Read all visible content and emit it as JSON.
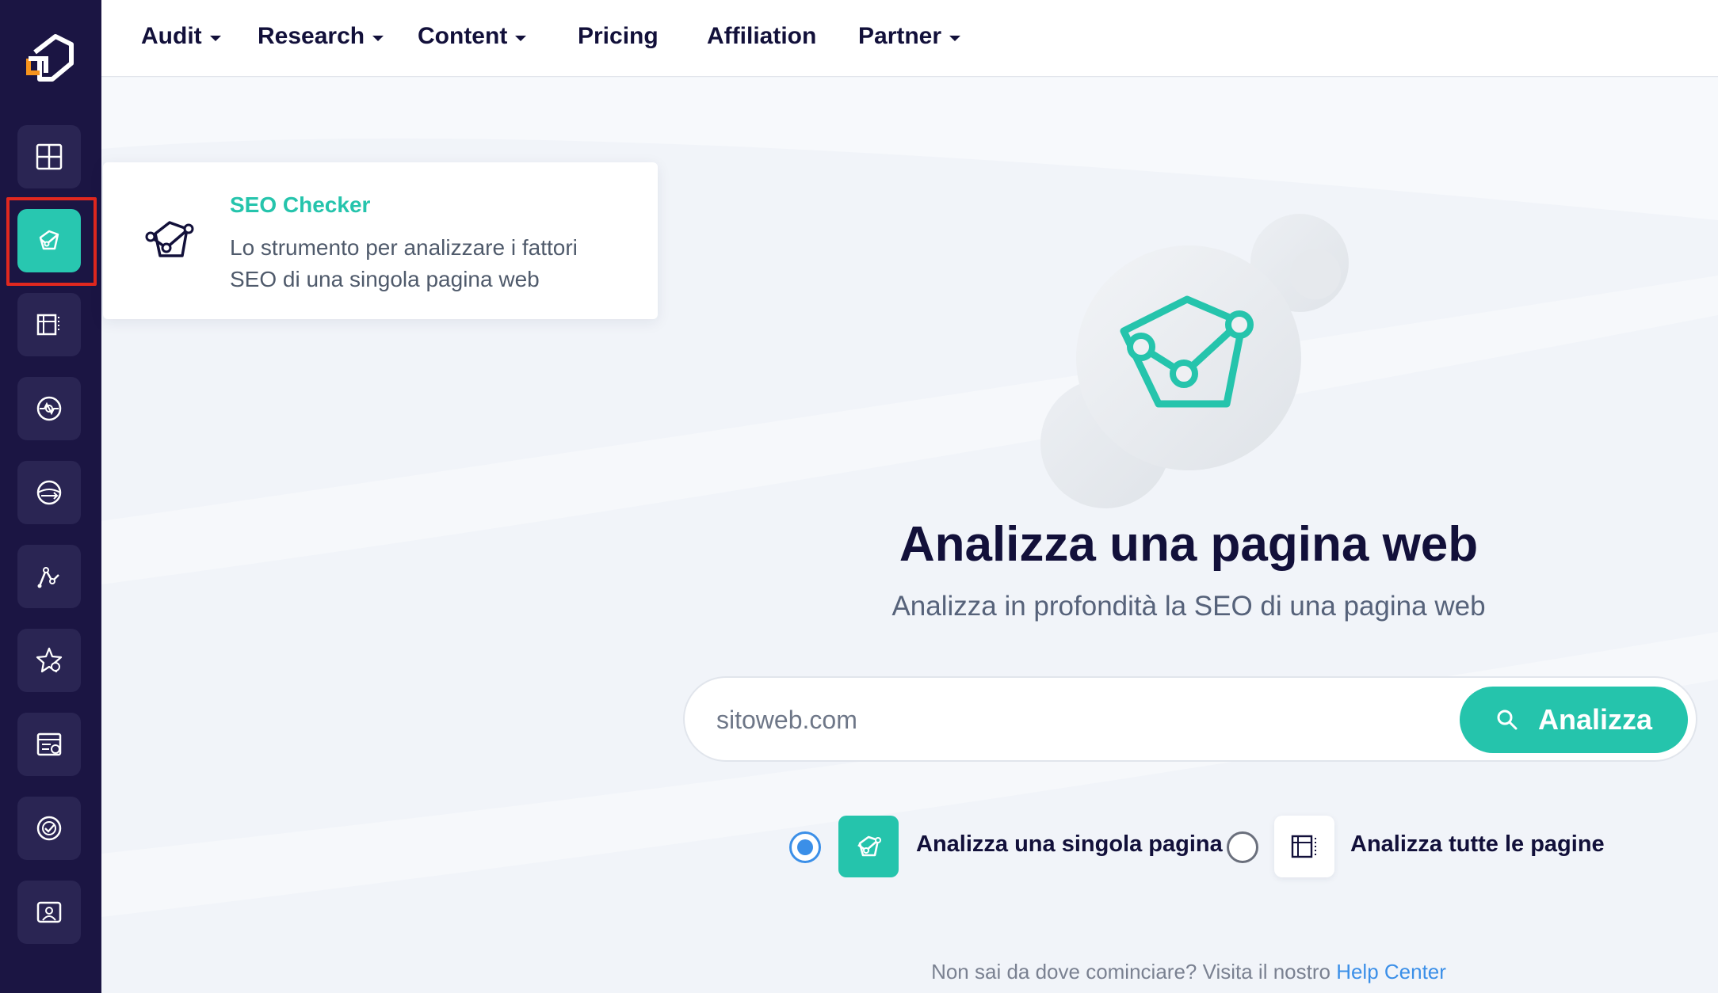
{
  "sidebar": {
    "logo_icon": "brand-logo-icon",
    "items": [
      {
        "icon": "dashboard-icon",
        "active": false
      },
      {
        "icon": "seo-checker-icon",
        "active": true
      },
      {
        "icon": "site-audit-icon",
        "active": false
      },
      {
        "icon": "keyword-research-icon",
        "active": false
      },
      {
        "icon": "serp-icon",
        "active": false
      },
      {
        "icon": "rank-tracker-icon",
        "active": false
      },
      {
        "icon": "favorites-icon",
        "active": false
      },
      {
        "icon": "content-report-icon",
        "active": false
      },
      {
        "icon": "check-target-icon",
        "active": false
      },
      {
        "icon": "user-profile-icon",
        "active": false
      }
    ]
  },
  "nav": {
    "items": [
      {
        "label": "Audit",
        "dropdown": true
      },
      {
        "label": "Research",
        "dropdown": true
      },
      {
        "label": "Content",
        "dropdown": true
      },
      {
        "label": "Pricing",
        "dropdown": false
      },
      {
        "label": "Affiliation",
        "dropdown": false
      },
      {
        "label": "Partner",
        "dropdown": true
      }
    ]
  },
  "tooltip": {
    "title": "SEO Checker",
    "description": "Lo strumento per analizzare i fattori SEO di una singola pagina web"
  },
  "main": {
    "title": "Analizza una pagina web",
    "subtitle": "Analizza in profondità la SEO di una pagina web",
    "search": {
      "placeholder": "sitoweb.com",
      "value": "",
      "button_label": "Analizza"
    },
    "options": [
      {
        "label": "Analizza una singola pagina",
        "selected": true
      },
      {
        "label": "Analizza tutte le pagine",
        "selected": false
      }
    ],
    "help_text": "Non sai da dove cominciare? Visita il nostro",
    "help_link": "Help Center"
  },
  "colors": {
    "sidebar_bg": "#1b1543",
    "accent": "#25c4ac",
    "link": "#3b8fe8",
    "highlight_outline": "#e1281f",
    "logo_orange": "#f7941d"
  }
}
